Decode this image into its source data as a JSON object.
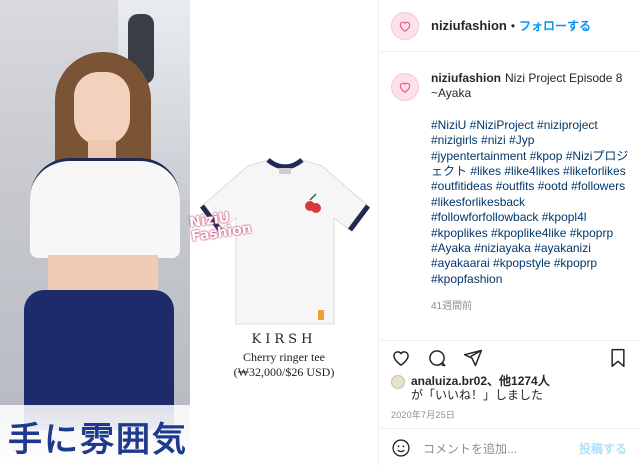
{
  "post_media": {
    "caption_overlay": "手に雰囲気を",
    "watermark": "NiziU\nFashion",
    "product": {
      "brand": "KIRSH",
      "name": "Cherry ringer tee",
      "price": "(₩32,000/$26 USD)"
    }
  },
  "header": {
    "username": "niziufashion",
    "separator": "•",
    "follow_label": "フォローする"
  },
  "caption": {
    "username": "niziufashion",
    "text": "Nizi Project Episode 8 ~Ayaka",
    "hashtags": "#NiziU #NiziProject #niziproject #nizigirls #nizi #Jyp #jypentertainment #kpop #Niziプロジェクト #likes #like4likes #likeforlikes #outfitideas #outfits #ootd #followers #likesforlikesback #followforfollowback #kpopl4l #kpoplikes #kpoplike4like #kpoprp #Ayaka #niziayaka #ayakanizi #ayakaarai #kpopstyle #kpoprp #kpopfashion",
    "age": "41週間前"
  },
  "likes": {
    "line1": "analuiza.br02、他1274人",
    "line2": "が「いいね！」しました"
  },
  "date": "2020年7月25日",
  "comment_box": {
    "placeholder": "コメントを追加...",
    "post_label": "投稿する"
  },
  "icons": [
    "heart-icon",
    "comment-icon",
    "share-icon",
    "bookmark-icon",
    "emoji-icon"
  ],
  "colors": {
    "follow": "#0095f6",
    "hashtag": "#00376b",
    "muted": "#8e8e8e",
    "post_disabled": "#b2dffc"
  }
}
